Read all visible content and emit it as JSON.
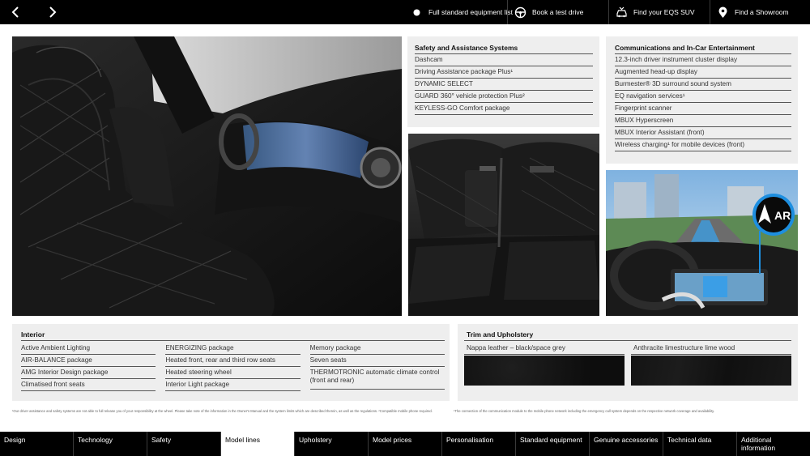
{
  "top_nav": {
    "actions": [
      {
        "label": "Full standard equipment list",
        "icon": "dot-icon"
      },
      {
        "label": "Book a test drive",
        "icon": "steering-wheel-icon"
      },
      {
        "label": "Find your EQS SUV",
        "icon": "car-icon"
      },
      {
        "label": "Find a Showroom",
        "icon": "location-pin-icon"
      }
    ]
  },
  "photos": {
    "ar_badge": "AR"
  },
  "safety": {
    "title": "Safety and Assistance Systems",
    "items": [
      "Dashcam",
      "Driving Assistance package Plus¹",
      "DYNAMIC SELECT",
      "GUARD 360° vehicle protection Plus²",
      "KEYLESS-GO Comfort package"
    ]
  },
  "comms": {
    "title": "Communications and In-Car Entertainment",
    "items": [
      "12.3-inch driver instrument cluster display",
      "Augmented head-up display",
      "Burmester® 3D surround sound system",
      "EQ navigation services¹",
      "Fingerprint scanner",
      "MBUX Hyperscreen",
      "MBUX Interior Assistant (front)",
      "Wireless charging¹ for mobile devices (front)"
    ]
  },
  "interior": {
    "title": "Interior",
    "col1": [
      "Active Ambient Lighting",
      "AIR-BALANCE package",
      "AMG Interior Design package",
      "Climatised front seats"
    ],
    "col2": [
      "ENERGIZING package",
      "Heated front, rear and third row seats",
      "Heated steering wheel",
      "Interior Light package"
    ],
    "col3": [
      "Memory package",
      "Seven seats",
      "THERMOTRONIC automatic climate control (front and rear)"
    ]
  },
  "trim": {
    "title": "Trim and Upholstery",
    "options": [
      {
        "label": "Nappa leather – black/space grey"
      },
      {
        "label": "Anthracite limestructure lime wood"
      }
    ]
  },
  "footnotes": {
    "left": "¹Our driver assistance and safety systems are not able to full release you of your responsibility at the wheel. Please take note of the information in the Owner's Manual and the system limits which are described therein, as well as the regulations.    ²Compatible mobile phone required.",
    "right": "¹The connection of the communication module to the mobile phone network including the emergency call system depends on the respective network coverage and availability."
  },
  "bottom_nav": {
    "items": [
      {
        "label": "Design",
        "active": false
      },
      {
        "label": "Technology",
        "active": false
      },
      {
        "label": "Safety",
        "active": false
      },
      {
        "label": "Model lines",
        "active": true
      },
      {
        "label": "Upholstery",
        "active": false
      },
      {
        "label": "Model prices",
        "active": false
      },
      {
        "label": "Personalisation",
        "active": false
      },
      {
        "label": "Standard equipment",
        "active": false
      },
      {
        "label": "Genuine accessories",
        "active": false
      },
      {
        "label": "Technical data",
        "active": false
      },
      {
        "label": "Additional information",
        "active": false
      }
    ]
  }
}
